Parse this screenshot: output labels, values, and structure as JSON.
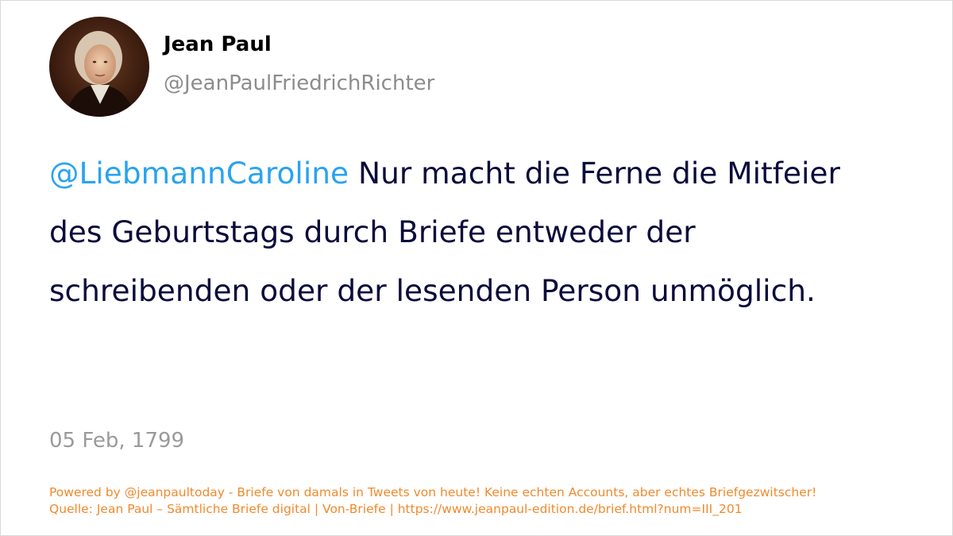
{
  "author": {
    "name": "Jean Paul",
    "handle": "@JeanPaulFriedrichRichter",
    "avatar_icon": "portrait-avatar"
  },
  "tweet": {
    "mention": "@LiebmannCaroline",
    "text": " Nur macht die Ferne die Mitfeier des Geburtstags durch Briefe entweder der schreibenden oder der lesenden Person unmöglich."
  },
  "date": "05 Feb, 1799",
  "footer": {
    "line1": "Powered by @jeanpaultoday - Briefe von damals in Tweets von heute! Keine echten Accounts, aber echtes Briefgezwitscher!",
    "line2": "Quelle: Jean Paul – Sämtliche Briefe digital | Von-Briefe | https://www.jeanpaul-edition.de/brief.html?num=III_201"
  },
  "colors": {
    "mention": "#2aa3ef",
    "text": "#0b0b3b",
    "muted": "#9a9a9a",
    "footer": "#f08a2e"
  }
}
